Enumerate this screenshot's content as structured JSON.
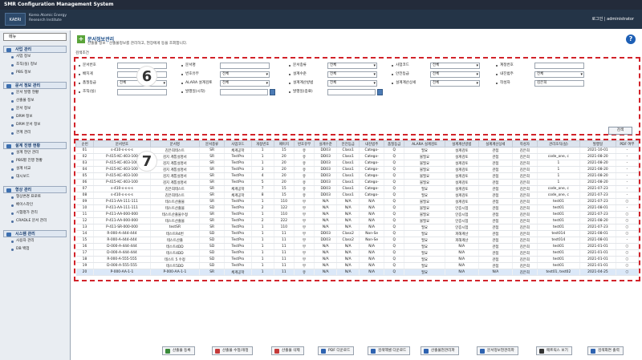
{
  "window": {
    "title": "SMR Configuration Management System"
  },
  "header": {
    "logo_text": "KAERI",
    "org_name_1": "Korea Atomic Energy",
    "org_name_2": "Research Institute",
    "user": "로그인 | administrator"
  },
  "sidebar": {
    "menu_title": "메뉴",
    "groups": [
      {
        "label": "사업 관리",
        "items": [
          "사업 정보",
          "조직(실) 정보",
          "PBS 정보"
        ]
      },
      {
        "label": "문서 정보 관리",
        "items": [
          "문서 발행 현황",
          "산출물 정보",
          "문서 정보",
          "DRM 정보",
          "DRM 문서 정보",
          "관계 관리"
        ]
      },
      {
        "label": "설계 진행 현황",
        "items": [
          "설계 현안 관리",
          "PBS별 진행 현황",
          "설계 비교",
          "대시보드"
        ]
      },
      {
        "label": "형상 관리",
        "items": [
          "형상변경 프로토",
          "베이스라인",
          "시험평가 관리",
          "CRADLE 문서 관리"
        ]
      },
      {
        "label": "시스템 관리",
        "items": [
          "사용자 관리",
          "DB 백업"
        ]
      }
    ]
  },
  "page": {
    "title": "문서정보관리",
    "subtitle": "산출물 정보 · 산출물정보를 관리하고, 현장에게 등을 조회합니다.",
    "condition_label": "검색조건"
  },
  "filters": {
    "row1": [
      {
        "label": "문서번호",
        "value": ""
      },
      {
        "label": "문서명",
        "value": ""
      },
      {
        "label": "문서종류",
        "value": "전체"
      },
      {
        "label": "사업코드",
        "value": "전체"
      },
      {
        "label": "계정번호",
        "value": ""
      }
    ],
    "row2": [
      {
        "label": "배치게",
        "value": ""
      },
      {
        "label": "번호유무",
        "value": "전체"
      },
      {
        "label": "설계수준",
        "value": "전체"
      },
      {
        "label": "안전등급",
        "value": "전체"
      },
      {
        "label": "내진범주",
        "value": "전체"
      }
    ],
    "row3": [
      {
        "label": "품질등급",
        "value": "전체"
      },
      {
        "label": "ALARA 설계검토",
        "value": "전체"
      },
      {
        "label": "설계계산방법",
        "value": "전체"
      },
      {
        "label": "설계계산상세",
        "value": "전체"
      },
      {
        "label": "작성자",
        "value": "김은희"
      }
    ],
    "row4": [
      {
        "label": "조직(실)",
        "value": ""
      },
      {
        "label": "발행일(시작)",
        "value": ""
      },
      {
        "label": "발행일(종료)",
        "value": ""
      }
    ],
    "search_label": "검색"
  },
  "markers": {
    "filter": "6",
    "grid": "7"
  },
  "table": {
    "columns": [
      "순번",
      "문서번호",
      "문서명",
      "문서종류",
      "사업코드",
      "개정번호",
      "페이지",
      "번호유무",
      "설계수준",
      "안전등급",
      "내진범주",
      "품질등급",
      "ALARA 설계검토",
      "설계계산방법",
      "설계계산상세",
      "작성자",
      "관리조직(실)",
      "발행일",
      "PDF 여부"
    ],
    "rows": [
      [
        "01",
        "s-410-s-s-s-s",
        "김은희테스트",
        "SR",
        "체계공학",
        "1",
        "15",
        "유",
        "DD03",
        "Class1",
        "Catego-",
        "Q",
        "필요",
        "설계검토",
        "관점",
        "김은희",
        "",
        "2021-10-01",
        "-"
      ],
      [
        "02",
        "P-415-KC-403-100",
        "검지 계통설명서",
        "SR",
        "TestPro",
        "1",
        "20",
        "유",
        "DD03",
        "Class1",
        "Catego-",
        "Q",
        "불필요",
        "설계검토",
        "관점",
        "김은희",
        "code_one, c",
        "2021-08-20",
        "-"
      ],
      [
        "03",
        "P-415-KC-403-100",
        "검지 계통설명서",
        "SR",
        "TestPro",
        "1",
        "20",
        "유",
        "DD03",
        "Class1",
        "Catego-",
        "Q",
        "불필요",
        "설계검토",
        "관점",
        "김은희",
        "1",
        "2021-08-20",
        "-"
      ],
      [
        "04",
        "P-415-KC-403-100",
        "검지 계통설명서",
        "SR",
        "TestPro",
        "3",
        "20",
        "유",
        "DD03",
        "Class1",
        "Catego-",
        "Q",
        "불필요",
        "설계검토",
        "관점",
        "김은희",
        "1",
        "2021-08-20",
        "-"
      ],
      [
        "05",
        "P-415-KC-403-100",
        "검지 계통설명서",
        "SR",
        "TestPro",
        "4",
        "20",
        "유",
        "DD03",
        "Class1",
        "Catego-",
        "Q",
        "불필요",
        "설계검토",
        "관점",
        "김은희",
        "1",
        "2021-08-20",
        "-"
      ],
      [
        "06",
        "P-415-KC-403-100",
        "검지 계통설명서",
        "SR",
        "TestPro",
        "5",
        "20",
        "유",
        "DD03",
        "Class1",
        "Catego-",
        "Q",
        "불필요",
        "설계검토",
        "관점",
        "김은희",
        "1",
        "2021-08-20",
        "-"
      ],
      [
        "07",
        "s-410-s-s-s-s",
        "김은희테스트",
        "SR",
        "체계공학",
        "7",
        "15",
        "유",
        "DD03",
        "Class1",
        "Catego-",
        "Q",
        "필요",
        "설계검토",
        "관점",
        "김은희",
        "code_one, c",
        "2021-07-23",
        "-"
      ],
      [
        "08",
        "s-410-s-s-s-s",
        "김은희테스트",
        "SR",
        "체계공학",
        "8",
        "15",
        "유",
        "DD03",
        "Class1",
        "Catego-",
        "Q",
        "필요",
        "설계검토",
        "관점",
        "김은희",
        "code_one, c",
        "2021-07-23",
        "-"
      ],
      [
        "09",
        "P-411-AA-111-111",
        "테스트산출물",
        "SR",
        "TestPro",
        "1",
        "110",
        "무",
        "N/A",
        "N/A",
        "N/A",
        "Q",
        "불필요",
        "설계검토",
        "관점",
        "김은희",
        "test01",
        "2021-07-23",
        "○"
      ],
      [
        "10",
        "P-411-AA-111-111",
        "테스트산출물",
        "SD",
        "TestPro",
        "2",
        "122",
        "무",
        "N/A",
        "N/A",
        "N/A",
        "Q",
        "불필요",
        "인증시험",
        "관점",
        "김은희",
        "test01",
        "2021-08-01",
        "-"
      ],
      [
        "11",
        "P-411-AA-000-000",
        "테스트산출물수정",
        "SR",
        "TestPro",
        "1",
        "110",
        "무",
        "N/A",
        "N/A",
        "N/A",
        "Q",
        "불필요",
        "인증시험",
        "관점",
        "김은희",
        "test01",
        "2021-07-23",
        "○"
      ],
      [
        "12",
        "P-411-AA-000-000",
        "테스트산출물",
        "SR",
        "TestPro",
        "2",
        "222",
        "무",
        "N/A",
        "N/A",
        "N/A",
        "Q",
        "불필요",
        "인증시험",
        "관점",
        "김은희",
        "test01",
        "2021-08-20",
        "○"
      ],
      [
        "13",
        "P-411-SR-000-000",
        "testSR",
        "SR",
        "TestPro",
        "1",
        "110",
        "무",
        "N/A",
        "N/A",
        "N/A",
        "Q",
        "필요",
        "인증시험",
        "관점",
        "김은희",
        "test01",
        "2021-07-23",
        "○"
      ],
      [
        "14",
        "R-000-A-444-444",
        "테스트R4번",
        "SD",
        "TestPro",
        "1",
        "11",
        "무",
        "DD03",
        "Class2",
        "Non-Se",
        "Q",
        "필요",
        "피해계산",
        "관점",
        "김은희",
        "test014",
        "2021-08-01",
        "○"
      ],
      [
        "15",
        "R-000-A-444-444",
        "테스트산출",
        "SD",
        "TestPro",
        "1",
        "11",
        "무",
        "DD03",
        "Class2",
        "Non-Se",
        "Q",
        "필요",
        "피해계산",
        "관점",
        "김은희",
        "test014",
        "2021-08-01",
        "-"
      ],
      [
        "16",
        "D-000-A-444-444",
        "테스트4DD",
        "SD",
        "TestPro",
        "1",
        "11",
        "무",
        "N/A",
        "N/A",
        "N/A",
        "Q",
        "필요",
        "N/A",
        "관점",
        "김은희",
        "test01",
        "2021-01-01",
        "○"
      ],
      [
        "17",
        "D-000-A-444-444",
        "테스트4DD",
        "SD",
        "TestPro",
        "1",
        "11",
        "무",
        "N/A",
        "N/A",
        "N/A",
        "Q",
        "필요",
        "N/A",
        "관점",
        "김은희",
        "test01",
        "2021-01-01",
        "○"
      ],
      [
        "18",
        "R-000-A-555-555",
        "테스트 5 수정",
        "SD",
        "TestPro",
        "1",
        "11",
        "무",
        "N/A",
        "N/A",
        "N/A",
        "Q",
        "필요",
        "N/A",
        "관점",
        "김은희",
        "test01",
        "2021-01-01",
        "○"
      ],
      [
        "19",
        "D-000-A-555-555",
        "테스트5DD",
        "SD",
        "TestPro",
        "1",
        "11",
        "무",
        "N/A",
        "N/A",
        "N/A",
        "Q",
        "필요",
        "N/A",
        "관점",
        "김은희",
        "test01",
        "2021-01-01",
        "○"
      ],
      [
        "20",
        "P-000-AA-1-1",
        "P-000-AA-1-1",
        "SR",
        "체계공학",
        "1",
        "11",
        "유",
        "N/A",
        "N/A",
        "N/A",
        "Q",
        "필요",
        "N/A",
        "N/A",
        "김은희",
        "test01, test02",
        "2021-04-25",
        "○"
      ]
    ]
  },
  "toolbar": {
    "buttons": [
      "산출물 등록",
      "산출물 수정/개정",
      "산출물 삭제",
      "PDF 다운로드",
      "검색엑셀 다운로드",
      "산출물현관리파",
      "문서정보현관리파",
      "매트릭스 보기",
      "검색화면 출력"
    ]
  }
}
